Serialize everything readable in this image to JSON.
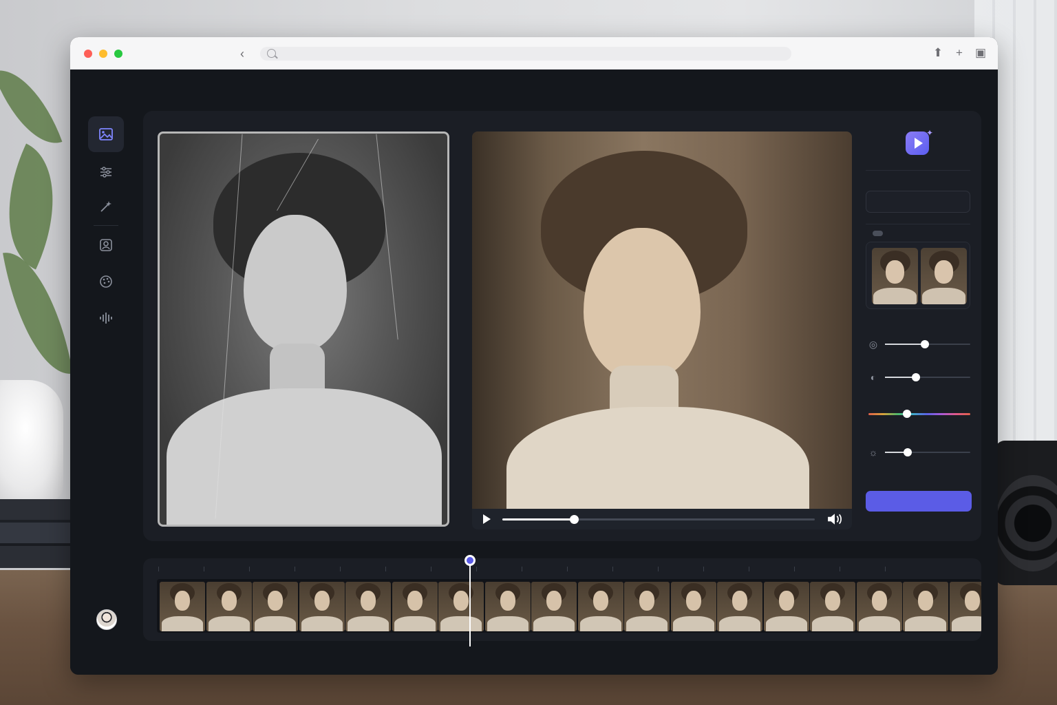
{
  "window": {
    "traffic_lights": [
      "close",
      "minimize",
      "zoom"
    ],
    "toolbar_icons": [
      "back-icon",
      "share-icon",
      "new-tab-icon",
      "tabs-icon"
    ],
    "url": ""
  },
  "sidebar": {
    "items": [
      {
        "name": "image-icon",
        "active": true
      },
      {
        "name": "sliders-icon",
        "active": false
      },
      {
        "name": "magic-wand-icon",
        "active": false
      },
      {
        "name": "portrait-icon",
        "active": false
      },
      {
        "name": "palette-icon",
        "active": false
      },
      {
        "name": "waveform-icon",
        "active": false
      }
    ],
    "avatar": "user-avatar"
  },
  "editor": {
    "before_image": "original-damaged-portrait",
    "after_image": "restored-animated-portrait",
    "player": {
      "progress": 0.23,
      "icons": [
        "play-icon",
        "volume-icon"
      ]
    }
  },
  "controls": {
    "logo": "video-sparkle-logo-icon",
    "input_value": "",
    "thumbnails": [
      "variant-1",
      "variant-2"
    ],
    "sliders": [
      {
        "icon": "exposure-icon",
        "value": 0.47
      },
      {
        "icon": "contrast-icon",
        "value": 0.36
      },
      {
        "icon": "hue-icon",
        "value": 0.38
      },
      {
        "icon": "brightness-icon",
        "value": 0.27
      }
    ],
    "primary_button_label": ""
  },
  "timeline": {
    "frame_count": 18,
    "playhead_position": 0.39
  },
  "colors": {
    "accent": "#5b5ce6",
    "app_bg": "#14171c",
    "panel_bg": "#1b1e25"
  }
}
